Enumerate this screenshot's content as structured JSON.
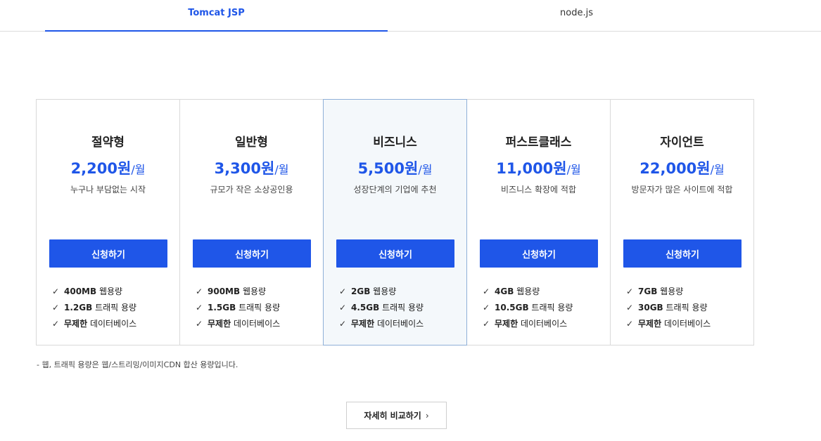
{
  "tabs": [
    {
      "label": "Tomcat JSP",
      "active": true
    },
    {
      "label": "node.js",
      "active": false
    }
  ],
  "colors": {
    "accent": "#1f56e8",
    "highlight_bg": "#f4f8fb",
    "highlight_border": "#8fb0d8"
  },
  "plans": [
    {
      "name": "절약형",
      "price": "2,200원",
      "unit": "/월",
      "desc": "누구나 부담없는 시작",
      "button": "신청하기",
      "features": [
        {
          "strong": "400MB",
          "text": " 웹용량"
        },
        {
          "strong": "1.2GB",
          "text": " 트래픽 용량"
        },
        {
          "strong": "무제한",
          "text": " 데이터베이스"
        }
      ]
    },
    {
      "name": "일반형",
      "price": "3,300원",
      "unit": "/월",
      "desc": "규모가 작은 소상공인용",
      "button": "신청하기",
      "features": [
        {
          "strong": "900MB",
          "text": " 웹용량"
        },
        {
          "strong": "1.5GB",
          "text": " 트래픽 용량"
        },
        {
          "strong": "무제한",
          "text": " 데이터베이스"
        }
      ]
    },
    {
      "name": "비즈니스",
      "price": "5,500원",
      "unit": "/월",
      "desc": "성장단계의 기업에 추천",
      "button": "신청하기",
      "features": [
        {
          "strong": "2GB",
          "text": " 웹용량"
        },
        {
          "strong": "4.5GB",
          "text": " 트래픽 용량"
        },
        {
          "strong": "무제한",
          "text": " 데이터베이스"
        }
      ]
    },
    {
      "name": "퍼스트클래스",
      "price": "11,000원",
      "unit": "/월",
      "desc": "비즈니스 확장에 적합",
      "button": "신청하기",
      "features": [
        {
          "strong": "4GB",
          "text": " 웹용량"
        },
        {
          "strong": "10.5GB",
          "text": " 트래픽 용량"
        },
        {
          "strong": "무제한",
          "text": " 데이터베이스"
        }
      ]
    },
    {
      "name": "자이언트",
      "price": "22,000원",
      "unit": "/월",
      "desc": "방문자가 많은 사이트에 적합",
      "button": "신청하기",
      "features": [
        {
          "strong": "7GB",
          "text": " 웹용량"
        },
        {
          "strong": "30GB",
          "text": " 트래픽 용량"
        },
        {
          "strong": "무제한",
          "text": " 데이터베이스"
        }
      ]
    }
  ],
  "footnote": "- 웹, 트래픽 용량은 웹/스트리밍/이미지CDN 합산 용량입니다.",
  "compare_button": "자세히 비교하기"
}
